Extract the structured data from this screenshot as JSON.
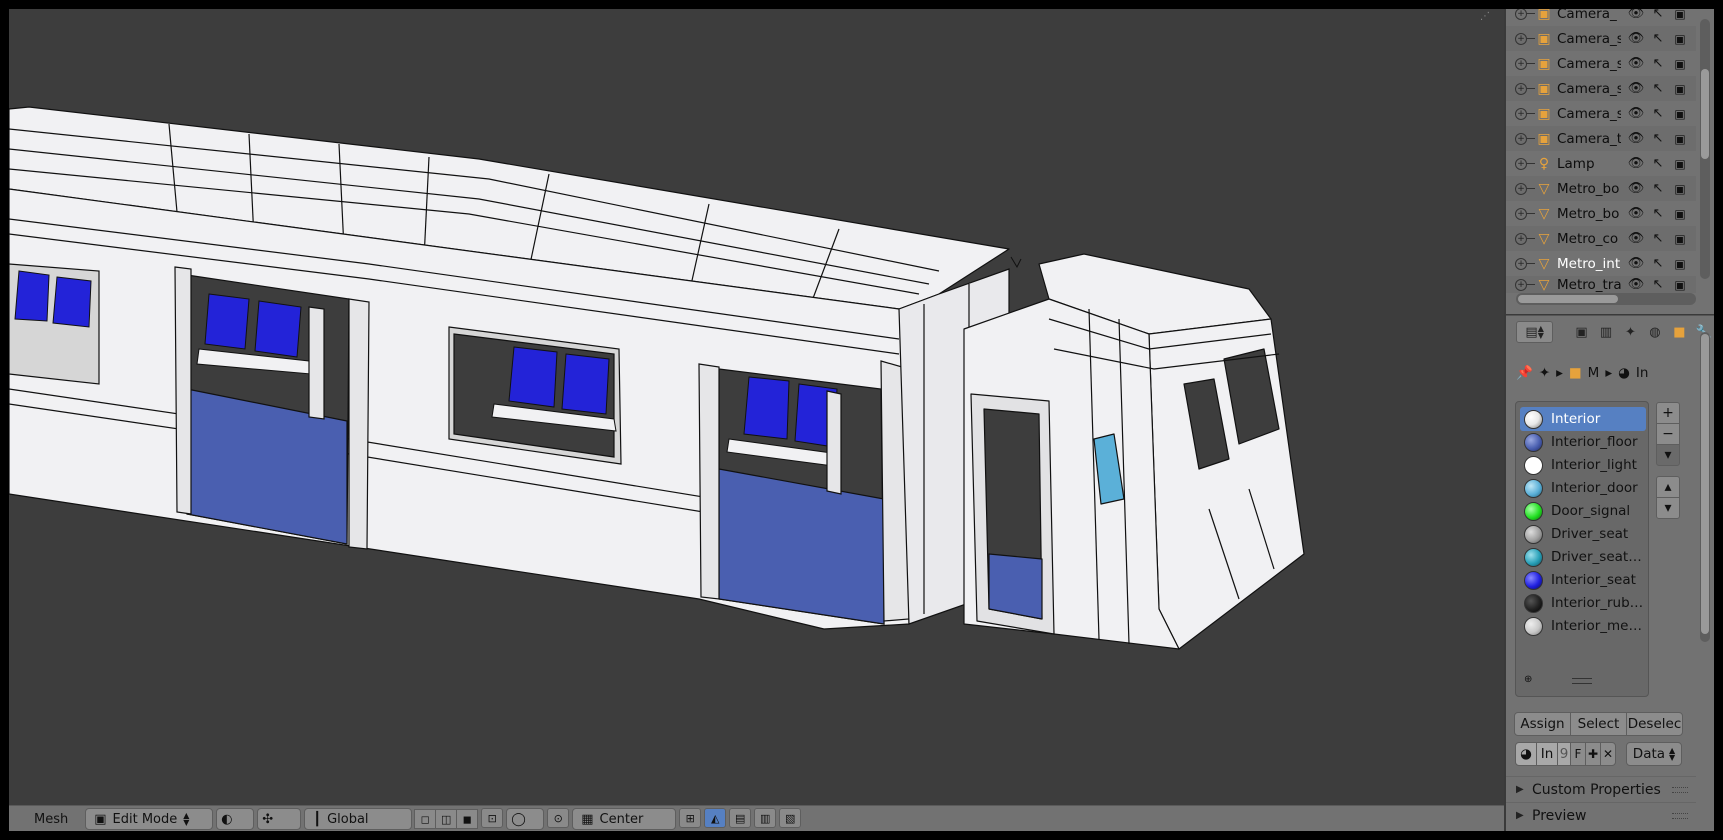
{
  "outliner": {
    "rows": [
      {
        "name": "Camera_",
        "icon": "camera-icon",
        "expand": "+"
      },
      {
        "name": "Camera_s",
        "icon": "camera-icon",
        "expand": "+"
      },
      {
        "name": "Camera_s",
        "icon": "camera-icon",
        "expand": "+"
      },
      {
        "name": "Camera_s",
        "icon": "camera-icon",
        "expand": "+"
      },
      {
        "name": "Camera_s",
        "icon": "camera-icon",
        "expand": "+"
      },
      {
        "name": "Camera_t",
        "icon": "camera-icon",
        "expand": "+"
      },
      {
        "name": "Lamp",
        "icon": "lamp-icon",
        "expand": "+"
      },
      {
        "name": "Metro_bo",
        "icon": "mesh-icon",
        "expand": "+"
      },
      {
        "name": "Metro_bo",
        "icon": "mesh-icon",
        "expand": "+"
      },
      {
        "name": "Metro_co",
        "icon": "mesh-icon",
        "expand": "+"
      },
      {
        "name": "Metro_int",
        "icon": "mesh-icon",
        "expand": "+"
      },
      {
        "name": "Metro_tra",
        "icon": "mesh-icon",
        "expand": "+"
      }
    ],
    "vis_glyph": "👁",
    "sel_glyph": "↖",
    "ren_glyph": "📷"
  },
  "properties": {
    "path": [
      "M",
      "In"
    ],
    "materials": [
      {
        "name": "Interior",
        "color": "#e8e8e8",
        "selected": true
      },
      {
        "name": "Interior_floor",
        "color": "#4a5fb0"
      },
      {
        "name": "Interior_light",
        "color": "#ffffff"
      },
      {
        "name": "Interior_door",
        "color": "#5bb0d8"
      },
      {
        "name": "Door_signal",
        "color": "#22e022"
      },
      {
        "name": "Driver_seat",
        "color": "#a0a0a0"
      },
      {
        "name": "Driver_seat…",
        "color": "#28a0b8"
      },
      {
        "name": "Interior_seat",
        "color": "#2020e0"
      },
      {
        "name": "Interior_rub…",
        "color": "#222222"
      },
      {
        "name": "Interior_me…",
        "color": "#c8c8c8"
      }
    ],
    "side_buttons": [
      "+",
      "−",
      "▾",
      "▴",
      "▾"
    ],
    "assign_label": "Assign",
    "select_label": "Select",
    "deselect_label": "Deselec",
    "slot_name": "In",
    "slot_users": "9",
    "slot_fake": "F",
    "data_label": "Data",
    "panels": [
      "Custom Properties",
      "Preview"
    ]
  },
  "viewport": {
    "header": {
      "menu_label": "Mesh",
      "mode": "Edit Mode",
      "orientation": "Global",
      "pivot": "Center"
    },
    "colors": {
      "background": "#3d3d3d",
      "body": "#f2f2f4",
      "floor": "#4a5fb0",
      "seat": "#2323d8"
    }
  }
}
